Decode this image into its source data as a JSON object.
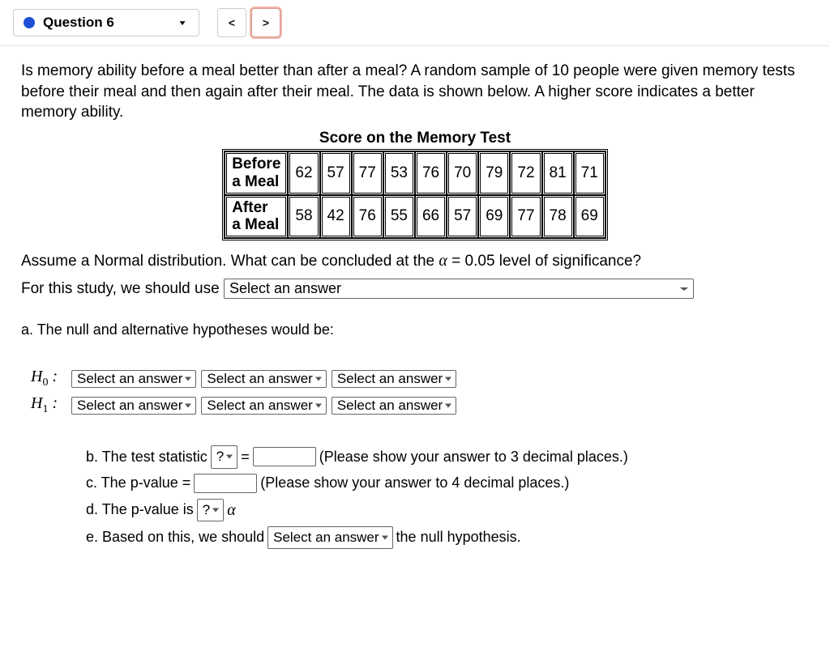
{
  "header": {
    "question_label": "Question 6",
    "prev": "<",
    "next": ">"
  },
  "prompt": "Is memory ability before a meal better than after a meal?  A random sample of 10 people were given memory tests before their meal and then again after their meal. The data is shown below. A higher score indicates a better memory ability.",
  "table": {
    "title": "Score on the Memory Test",
    "rows": [
      {
        "label": "Before a Meal",
        "values": [
          "62",
          "57",
          "77",
          "53",
          "76",
          "70",
          "79",
          "72",
          "81",
          "71"
        ]
      },
      {
        "label": "After a Meal",
        "values": [
          "58",
          "42",
          "76",
          "55",
          "66",
          "57",
          "69",
          "77",
          "78",
          "69"
        ]
      }
    ]
  },
  "assume": "Assume a Normal distribution.  What can be concluded at the  ",
  "assume_tail": " = 0.05 level of significance?",
  "study_lead": "For this study, we should use ",
  "select_placeholder": "Select an answer",
  "part_a_intro": "a. The null and alternative hypotheses would be:",
  "h0": "H",
  "h1": "H",
  "h0_sub": "0",
  "h1_sub": "1",
  "colon": " :",
  "b": {
    "lead": "b. The test statistic ",
    "eq": " = ",
    "tail": " (Please show your answer to 3 decimal places.)",
    "sel": "?"
  },
  "c": {
    "lead": "c. The p-value = ",
    "tail": " (Please show your answer to 4 decimal places.)"
  },
  "d": {
    "lead": "d. The p-value is ",
    "sel": "?"
  },
  "e": {
    "lead": "e. Based on this, we should ",
    "tail": " the null hypothesis."
  },
  "alpha": "α"
}
